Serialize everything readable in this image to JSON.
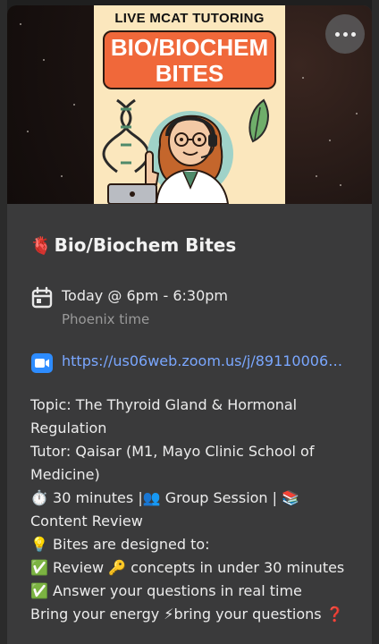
{
  "banner": {
    "poster_top": "LIVE MCAT TUTORING",
    "poster_line1": "BIO/BIOCHEM",
    "poster_line2": "BITES"
  },
  "menu": {
    "more_icon": "more-horizontal-icon"
  },
  "event": {
    "title_emoji": "🫀",
    "title": "Bio/Biochem Bites",
    "when": "Today @ 6pm - 6:30pm",
    "timezone": "Phoenix time",
    "link": "https://us06web.zoom.us/j/891100067…"
  },
  "description": {
    "topic": "Topic: The Thyroid Gland & Hormonal Regulation",
    "tutor": "Tutor: Qaisar (M1, Mayo Clinic School of Medicine)",
    "format_emoji_1": "⏱️",
    "format_text_1": "30 minutes |",
    "format_emoji_2": "👥",
    "format_text_2": "Group Session |",
    "format_emoji_3": "📚",
    "format_text_3": "Content Review",
    "bites_emoji": "💡",
    "bites_text": "Bites are designed to:",
    "check_emoji": "✅",
    "review_text_a": "Review",
    "key_emoji": "🔑",
    "review_text_b": "concepts in under 30 minutes",
    "answer_text": "Answer your questions in real time",
    "energy_text_a": "Bring your energy",
    "bolt_emoji": "⚡",
    "energy_text_b": "bring your questions",
    "question_emoji": "❓"
  },
  "colors": {
    "card": "#3a3a3b",
    "link": "#7aa7ff",
    "poster_badge": "#f0683a",
    "zoom": "#2d8cff"
  }
}
